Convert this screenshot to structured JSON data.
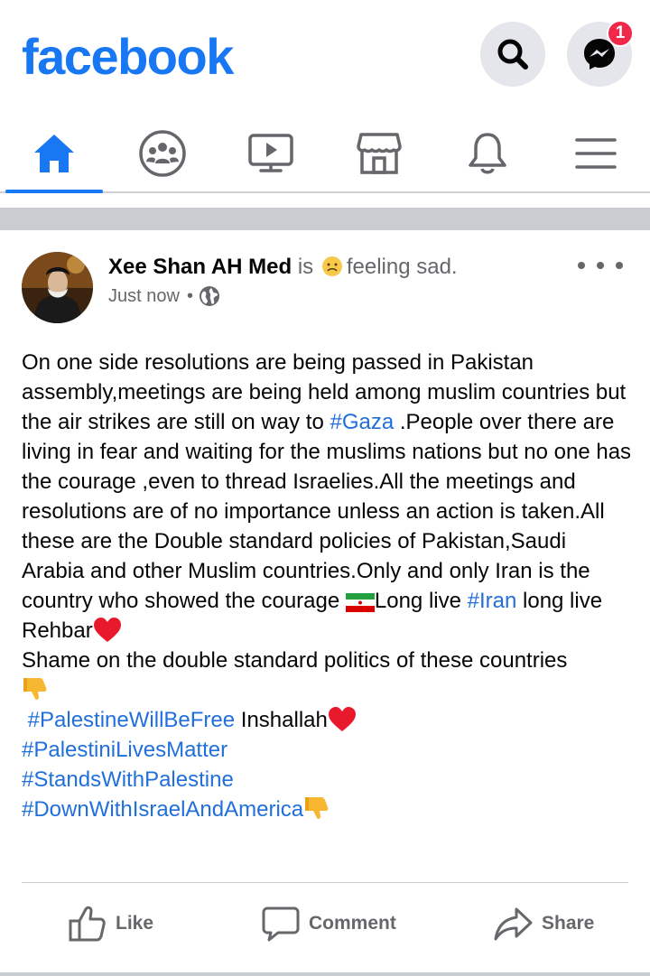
{
  "app": {
    "logo_text": "facebook",
    "brand_color": "#1877f2",
    "messenger_badge": "1"
  },
  "nav": {
    "items": [
      {
        "icon": "home-icon",
        "active": true
      },
      {
        "icon": "groups-icon",
        "active": false
      },
      {
        "icon": "watch-icon",
        "active": false
      },
      {
        "icon": "marketplace-icon",
        "active": false
      },
      {
        "icon": "notifications-icon",
        "active": false
      },
      {
        "icon": "menu-icon",
        "active": false
      }
    ]
  },
  "post": {
    "author": "Xee Shan AH Med",
    "is_word": "is",
    "feeling": "feeling sad.",
    "feeling_icon": "sad-face-icon",
    "time": "Just now",
    "privacy_icon": "globe-icon",
    "body": {
      "seg1": "On one side resolutions are being passed in Pakistan assembly,meetings are being held among muslim countries but the  air strikes are still on way to ",
      "tag_gaza": "#Gaza",
      "seg2": " .People over there are living in fear and waiting for the muslims nations but no one has the courage ,even to thread Israelies.All the meetings and resolutions are of no importance unless an action is taken.All these are the Double standard policies of Pakistan,Saudi Arabia and other Muslim countries.Only and only Iran is the country who showed the courage ",
      "seg3": "Long live ",
      "tag_iran": "#Iran",
      "seg4": " long live Rehbar",
      "seg5": "Shame on the double standard politics of these countries",
      "tag_palestine_free": "#PalestineWillBeFree",
      "inshallah": " Inshallah",
      "tag_lives": "#PalestiniLivesMatter",
      "tag_stands": "#StandsWithPalestine",
      "tag_down": "#DownWithIsraelAndAmerica"
    },
    "actions": {
      "like": "Like",
      "comment": "Comment",
      "share": "Share"
    }
  }
}
